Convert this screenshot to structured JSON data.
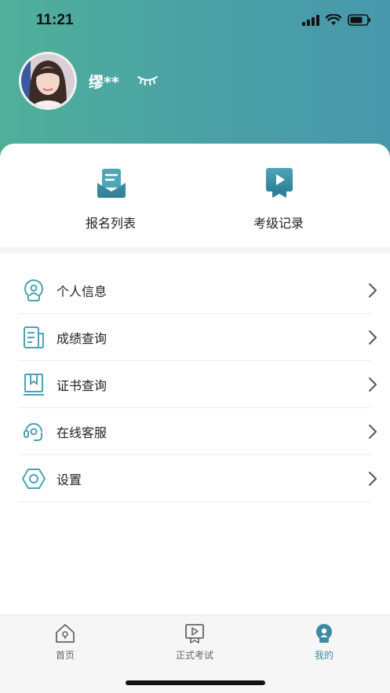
{
  "status_bar": {
    "time": "11:21"
  },
  "profile": {
    "username": "缪**"
  },
  "quick_actions": [
    {
      "label": "报名列表",
      "icon": "envelope-list-icon"
    },
    {
      "label": "考级记录",
      "icon": "video-play-icon"
    }
  ],
  "menu": [
    {
      "label": "个人信息",
      "icon": "bulb-person-icon"
    },
    {
      "label": "成绩查询",
      "icon": "document-icon"
    },
    {
      "label": "证书查询",
      "icon": "certificate-book-icon"
    },
    {
      "label": "在线客服",
      "icon": "headset-icon"
    },
    {
      "label": "设置",
      "icon": "hexagon-gear-icon"
    }
  ],
  "tabbar": [
    {
      "label": "首页",
      "icon": "home-icon",
      "active": false
    },
    {
      "label": "正式考试",
      "icon": "exam-play-icon",
      "active": false
    },
    {
      "label": "我的",
      "icon": "profile-icon",
      "active": true
    }
  ],
  "colors": {
    "header_start": "#4fb09a",
    "header_end": "#4898ac",
    "accent": "#3f8aa0"
  }
}
